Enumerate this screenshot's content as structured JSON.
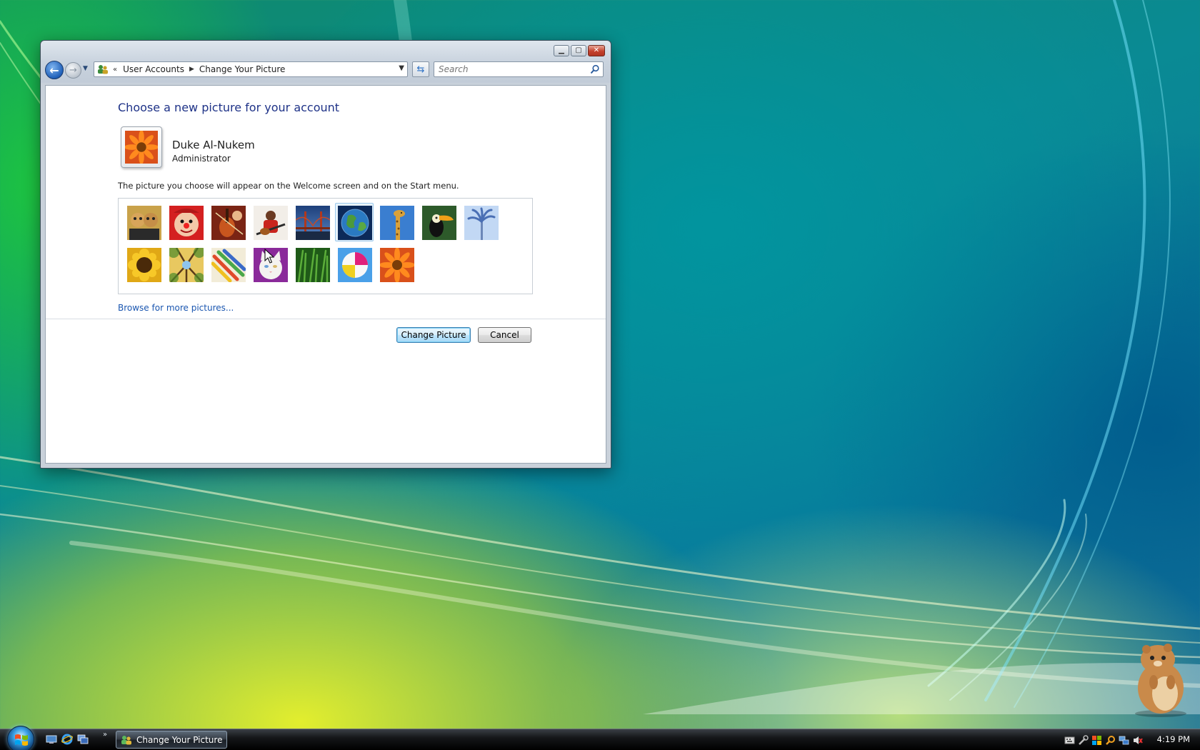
{
  "window": {
    "breadcrumb": [
      "User Accounts",
      "Change Your Picture"
    ],
    "breadcrumb_overflow": "«",
    "search_placeholder": "Search",
    "caption_buttons": [
      "minimize",
      "maximize",
      "close"
    ]
  },
  "page": {
    "title": "Choose a new picture for your account",
    "user_name": "Duke Al-Nukem",
    "user_role": "Administrator",
    "description": "The picture you choose will appear on the Welcome screen and on the Start menu.",
    "browse_link": "Browse for more pictures...",
    "change_button": "Change Picture",
    "cancel_button": "Cancel"
  },
  "pictures": [
    {
      "name": "puppets",
      "selected": false
    },
    {
      "name": "clown-face",
      "selected": false
    },
    {
      "name": "violin",
      "selected": false
    },
    {
      "name": "guitarist",
      "selected": false
    },
    {
      "name": "bridge",
      "selected": false
    },
    {
      "name": "earth-globe",
      "selected": true
    },
    {
      "name": "giraffe",
      "selected": false
    },
    {
      "name": "toucan",
      "selected": false
    },
    {
      "name": "palm-tree",
      "selected": false
    },
    {
      "name": "sunflower",
      "selected": false
    },
    {
      "name": "forest-trees",
      "selected": false
    },
    {
      "name": "pencils",
      "selected": false
    },
    {
      "name": "white-cat",
      "selected": false
    },
    {
      "name": "grass",
      "selected": false
    },
    {
      "name": "beach-ball",
      "selected": false
    },
    {
      "name": "orange-gerbera",
      "selected": false
    }
  ],
  "taskbar": {
    "task_label": "Change Your Picture",
    "clock": "4:19 PM"
  }
}
